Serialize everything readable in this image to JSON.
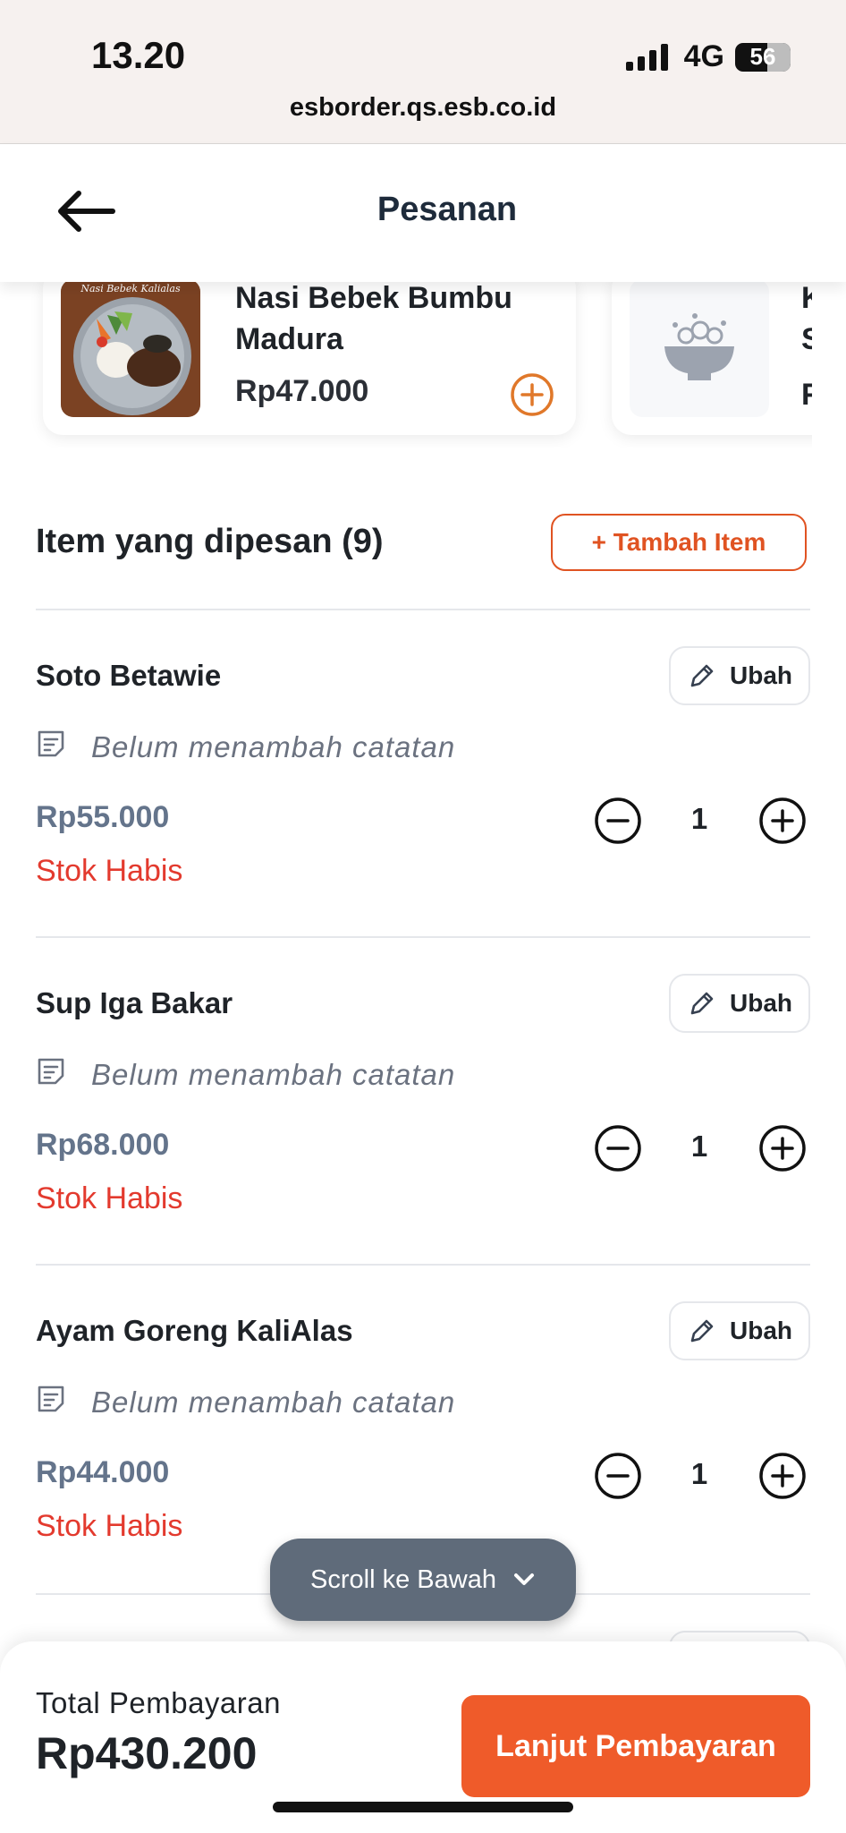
{
  "status_bar": {
    "time": "13.20",
    "network": "4G",
    "battery": "56",
    "url": "esborder.qs.esb.co.id"
  },
  "header": {
    "title": "Pesanan"
  },
  "recommendations": [
    {
      "name": "Nasi Bebek Bumbu Madura",
      "price": "Rp47.000",
      "image_caption": "Nasi Bebek Kalialas"
    },
    {
      "name": "K S",
      "price": "F"
    }
  ],
  "ordered": {
    "title": "Item yang dipesan (9)",
    "add_button": "+ Tambah Item",
    "edit_label": "Ubah",
    "note_placeholder": "Belum menambah catatan",
    "items": [
      {
        "name": "Soto Betawie",
        "price": "Rp55.000",
        "status": "Stok Habis",
        "qty": "1"
      },
      {
        "name": "Sup Iga Bakar",
        "price": "Rp68.000",
        "status": "Stok Habis",
        "qty": "1"
      },
      {
        "name": "Ayam Goreng KaliAlas",
        "price": "Rp44.000",
        "status": "Stok Habis",
        "qty": "1"
      }
    ]
  },
  "scroll_toast": "Scroll ke Bawah",
  "footer": {
    "total_label": "Total Pembayaran",
    "total_value": "Rp430.200",
    "pay_button": "Lanjut Pembayaran"
  },
  "colors": {
    "accent": "#EF5B2A",
    "out_of_stock": "#E33A2E",
    "price_gray": "#64748B"
  }
}
